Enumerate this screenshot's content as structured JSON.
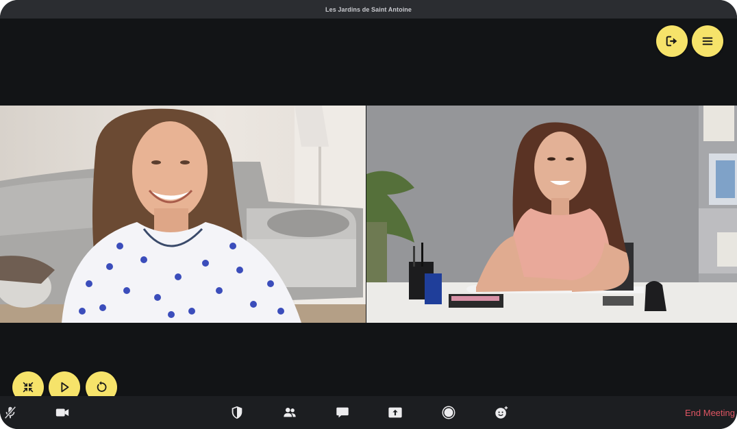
{
  "window": {
    "title": "Les Jardins de Saint Antoine"
  },
  "top_controls": [
    {
      "icon": "leave-icon",
      "action": "leave"
    },
    {
      "icon": "menu-icon",
      "action": "menu"
    }
  ],
  "playback_controls": [
    {
      "icon": "minimize-icon"
    },
    {
      "icon": "play-icon"
    },
    {
      "icon": "replay-icon"
    }
  ],
  "toolbar": {
    "items": [
      {
        "icon": "mic-muted-icon"
      },
      {
        "icon": "video-camera-icon"
      },
      {
        "icon": "security-shield-icon"
      },
      {
        "icon": "participants-icon"
      },
      {
        "icon": "chat-icon"
      },
      {
        "icon": "share-screen-icon"
      },
      {
        "icon": "record-icon"
      },
      {
        "icon": "reactions-icon"
      }
    ],
    "end_meeting_label": "End Meeting"
  },
  "colors": {
    "accent_yellow": "#f6e36a",
    "end_meeting_red": "#e05563",
    "background": "#121416",
    "toolbar": "#1c1e21"
  }
}
